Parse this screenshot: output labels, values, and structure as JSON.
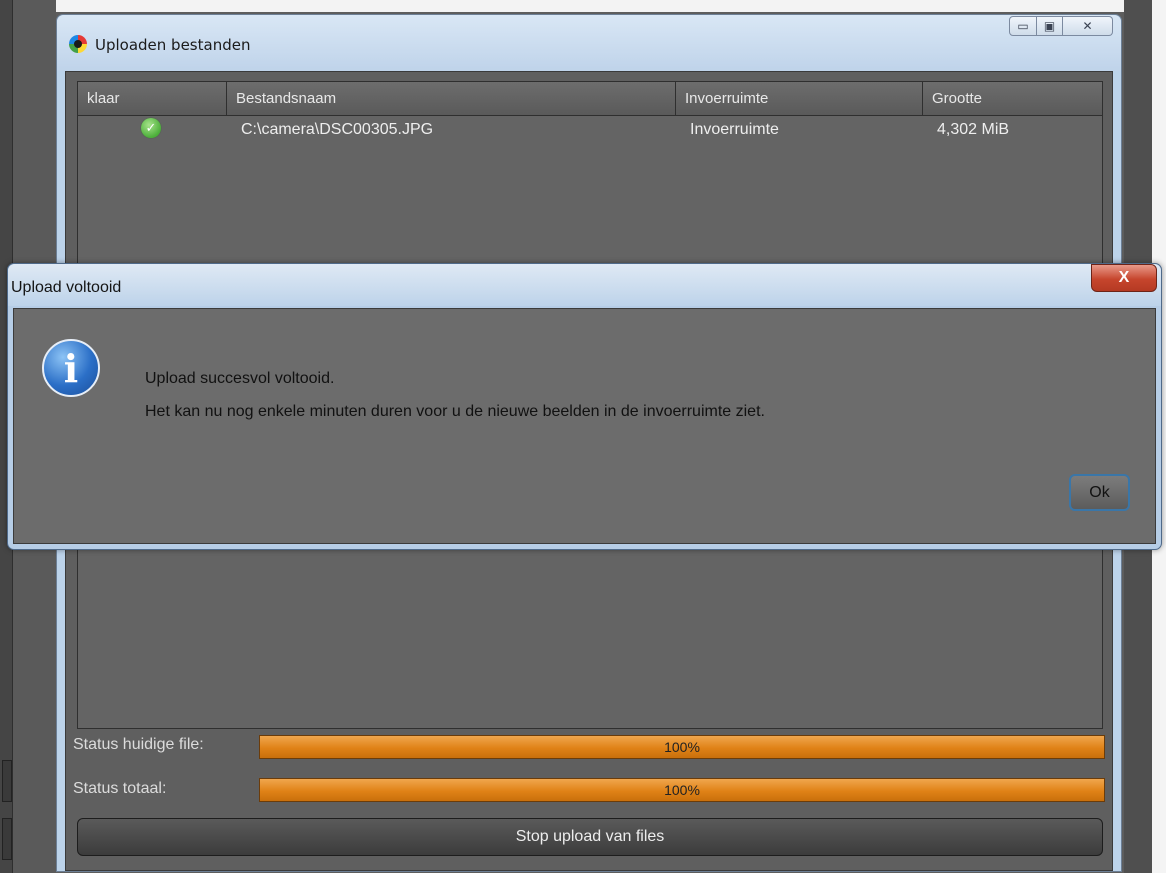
{
  "main_window": {
    "title": "Uploaden bestanden",
    "controls": {
      "minimize": "▭",
      "maximize": "▣",
      "close": "✕"
    }
  },
  "table": {
    "columns": [
      "klaar",
      "Bestandsnaam",
      "Invoerruimte",
      "Grootte"
    ],
    "rows": [
      {
        "done": true,
        "filename": "C:\\camera\\DSC00305.JPG",
        "space": "Invoerruimte",
        "size": "4,302 MiB"
      }
    ]
  },
  "status": {
    "current_label": "Status huidige file:",
    "current_value": "100%",
    "current_fraction": 1.0,
    "total_label": "Status totaal:",
    "total_value": "100%",
    "total_fraction": 1.0
  },
  "stop_button_label": "Stop upload van files",
  "dialog": {
    "title": "Upload voltooid",
    "close_glyph": "X",
    "icon": "info-icon",
    "message_line1": "Upload succesvol voltooid.",
    "message_line2": "Het kan nu nog enkele minuten duren voor u de nieuwe beelden in de invoerruimte ziet.",
    "ok_label": "Ok"
  },
  "colors": {
    "progress": "#e08217",
    "dialog_close": "#c6452d",
    "info_icon": "#2b6fc7"
  }
}
